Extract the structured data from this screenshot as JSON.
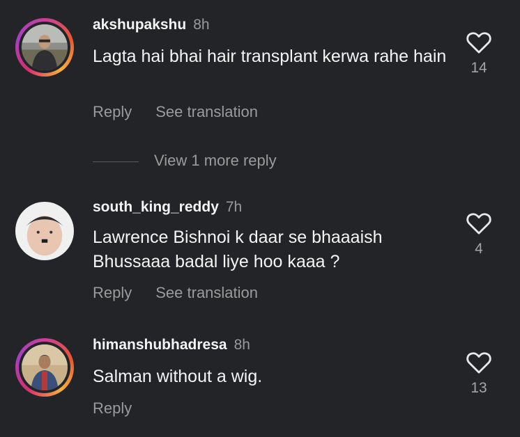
{
  "comments": [
    {
      "username": "akshupakshu",
      "time": "8h",
      "text": "Lagta hai bhai hair transplant kerwa rahe hain",
      "actions": [
        "Reply",
        "See translation"
      ],
      "likes": "14",
      "avatar_story_ring": true
    },
    {
      "username": "south_king_reddy",
      "time": "7h",
      "text": "Lawrence Bishnoi k daar se bhaaaish Bhussaaa badal liye hoo kaaa ?",
      "actions": [
        "Reply",
        "See translation"
      ],
      "likes": "4",
      "avatar_story_ring": false
    },
    {
      "username": "himanshubhadresa",
      "time": "8h",
      "text": "Salman without a wig.",
      "actions": [
        "Reply"
      ],
      "likes": "13",
      "avatar_story_ring": true
    }
  ],
  "view_more_replies": "View 1 more reply",
  "icons": {
    "like": "heart-outline-icon"
  },
  "colors": {
    "background": "#232427",
    "text_primary": "#f4f4f4",
    "text_secondary": "#9b9b9b",
    "story_ring_start": "#c93f9b",
    "story_ring_mid": "#f5b03a"
  }
}
